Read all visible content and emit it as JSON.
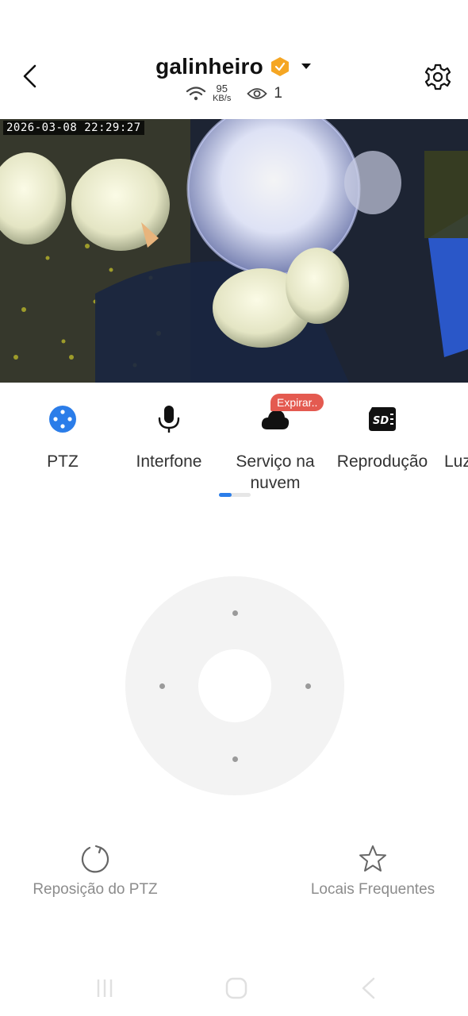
{
  "header": {
    "title": "galinheiro",
    "wifi_speed_value": "95",
    "wifi_speed_unit": "KB/s",
    "viewer_count": "1"
  },
  "video": {
    "timestamp": "2026-03-08 22:29:27"
  },
  "tabs": [
    {
      "label": "PTZ",
      "icon": "ptz-icon",
      "active": true
    },
    {
      "label": "Interfone",
      "icon": "microphone-icon"
    },
    {
      "label": "Serviço na nuvem",
      "icon": "cloud-icon",
      "badge": "Expirar.."
    },
    {
      "label": "Reprodução",
      "icon": "sd-card-icon"
    },
    {
      "label": "Luz",
      "icon": "light-icon"
    }
  ],
  "actions": {
    "reset_label": "Reposição do PTZ",
    "favorites_label": "Locais Frequentes"
  },
  "colors": {
    "accent": "#2b7de9",
    "badge": "#e45a50",
    "premium_badge": "#f5a623"
  }
}
